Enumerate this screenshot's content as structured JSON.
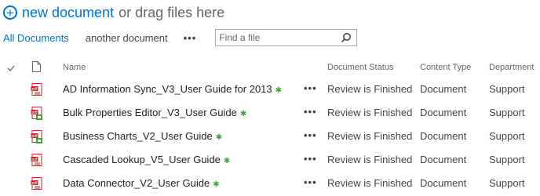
{
  "header": {
    "new_document_label": "new document",
    "drag_text": "or drag files here"
  },
  "views": {
    "all_documents": "All Documents",
    "another_document": "another document",
    "more": "•••"
  },
  "search": {
    "placeholder": "Find a file",
    "value": ""
  },
  "columns": {
    "name": "Name",
    "status": "Document Status",
    "content_type": "Content Type",
    "department": "Department"
  },
  "rows": [
    {
      "name": "AD Information Sync_V3_User Guide for 2013",
      "icon": "pdf-file-icon",
      "new_marker": "✱",
      "menu": "•••",
      "status": "Review is Finished",
      "content_type": "Document",
      "department": "Support"
    },
    {
      "name": "Bulk Properties Editor_V3_User Guide",
      "icon": "pdf-exe-file-icon",
      "new_marker": "✱",
      "menu": "•••",
      "status": "Review is Finished",
      "content_type": "Document",
      "department": "Support"
    },
    {
      "name": "Business Charts_V2_User Guide",
      "icon": "pdf-exe-file-icon",
      "new_marker": "✱",
      "menu": "•••",
      "status": "Review is Finished",
      "content_type": "Document",
      "department": "Support"
    },
    {
      "name": "Cascaded Lookup_V5_User Guide",
      "icon": "pdf-file-icon",
      "new_marker": "✱",
      "menu": "•••",
      "status": "Review is Finished",
      "content_type": "Document",
      "department": "Support"
    },
    {
      "name": "Data Connector_V2_User Guide",
      "icon": "pdf-file-icon",
      "new_marker": "✱",
      "menu": "•••",
      "status": "Review is Finished",
      "content_type": "Document",
      "department": "Support"
    }
  ],
  "colors": {
    "accent": "#0072c6",
    "new_marker": "#46a046",
    "pdf_red": "#c1272d",
    "exe_green": "#4a9d3c"
  }
}
